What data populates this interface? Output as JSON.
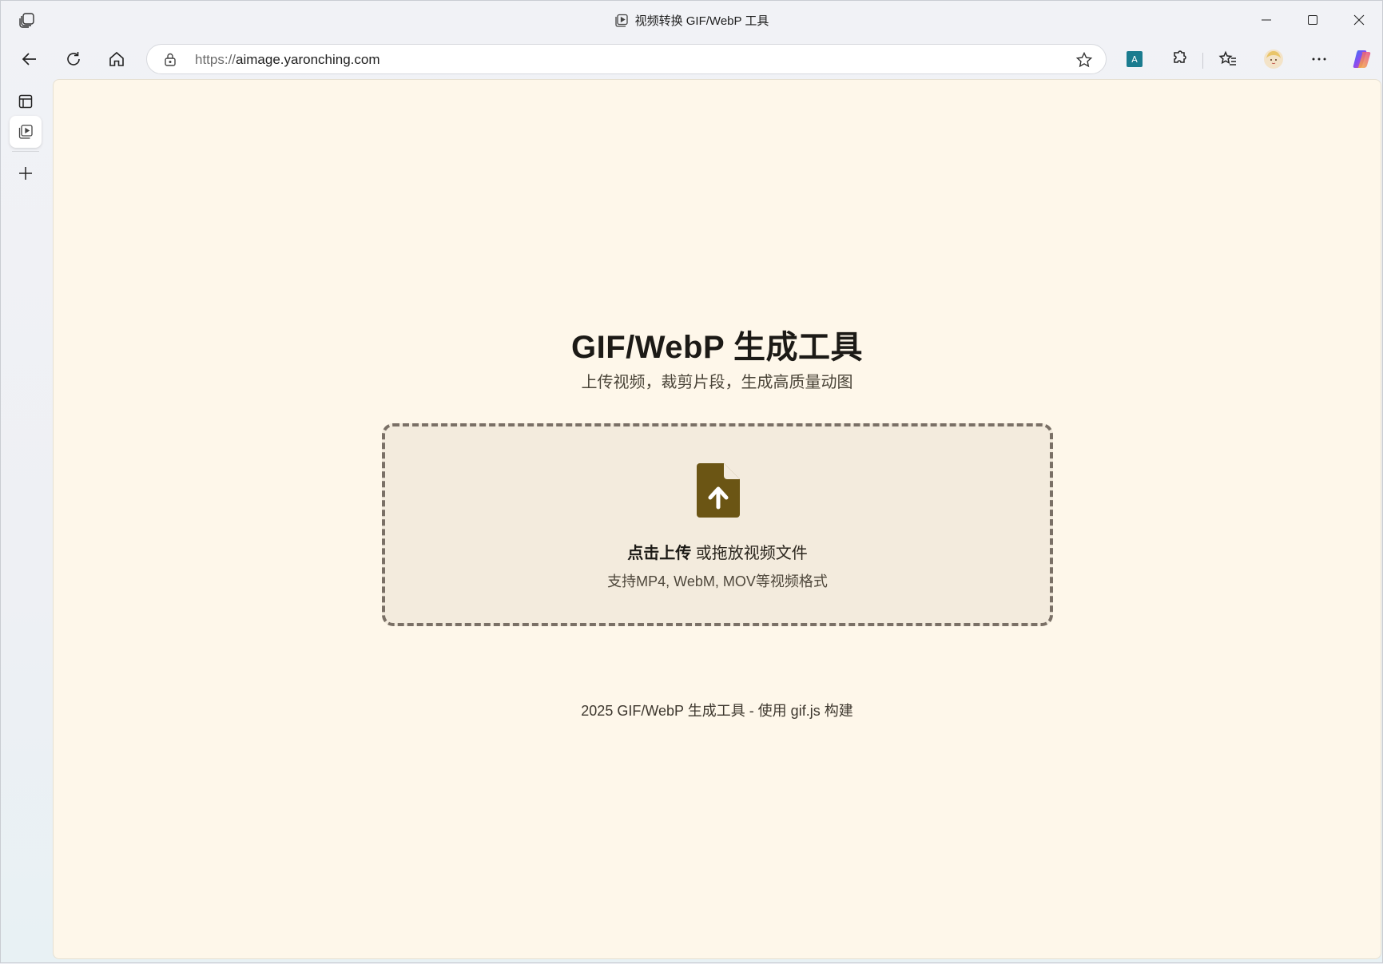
{
  "window": {
    "title": "视频转换 GIF/WebP 工具"
  },
  "toolbar": {
    "url_scheme": "https://",
    "url_host": "aimage.yaronching.com"
  },
  "page": {
    "title": "GIF/WebP 生成工具",
    "subtitle": "上传视频，裁剪片段，生成高质量动图",
    "upload_click": "点击上传",
    "upload_rest": " 或拖放视频文件",
    "upload_hint": "支持MP4, WebM, MOV等视频格式",
    "footer": "2025 GIF/WebP 生成工具 - 使用 gif.js 构建"
  },
  "colors": {
    "page_bg": "#fef7ea",
    "dropzone_bg": "#f3ebdd",
    "dropzone_border": "#7a7066",
    "upload_icon": "#6b5514"
  }
}
